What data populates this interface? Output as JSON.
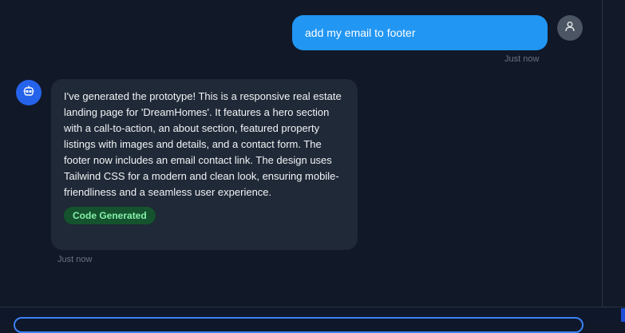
{
  "messages": {
    "user": {
      "text": "add my email to footer",
      "time": "Just now",
      "avatar_icon": "user-icon"
    },
    "assistant": {
      "text": "I've generated the prototype! This is a responsive real estate landing page for 'DreamHomes'. It features a hero section with a call-to-action, an about section, featured property listings with images and details, and a contact form. The footer now includes an email contact link. The design uses Tailwind CSS for a modern and clean look, ensuring mobile-friendliness and a seamless user experience.",
      "badge": "Code Generated",
      "time": "Just now",
      "avatar_icon": "bot-icon"
    }
  },
  "colors": {
    "background": "#111827",
    "user_bubble": "#2196f3",
    "assistant_bubble": "#1f2937",
    "badge_bg": "#14532d",
    "badge_text": "#86efac",
    "accent": "#3b82f6"
  }
}
